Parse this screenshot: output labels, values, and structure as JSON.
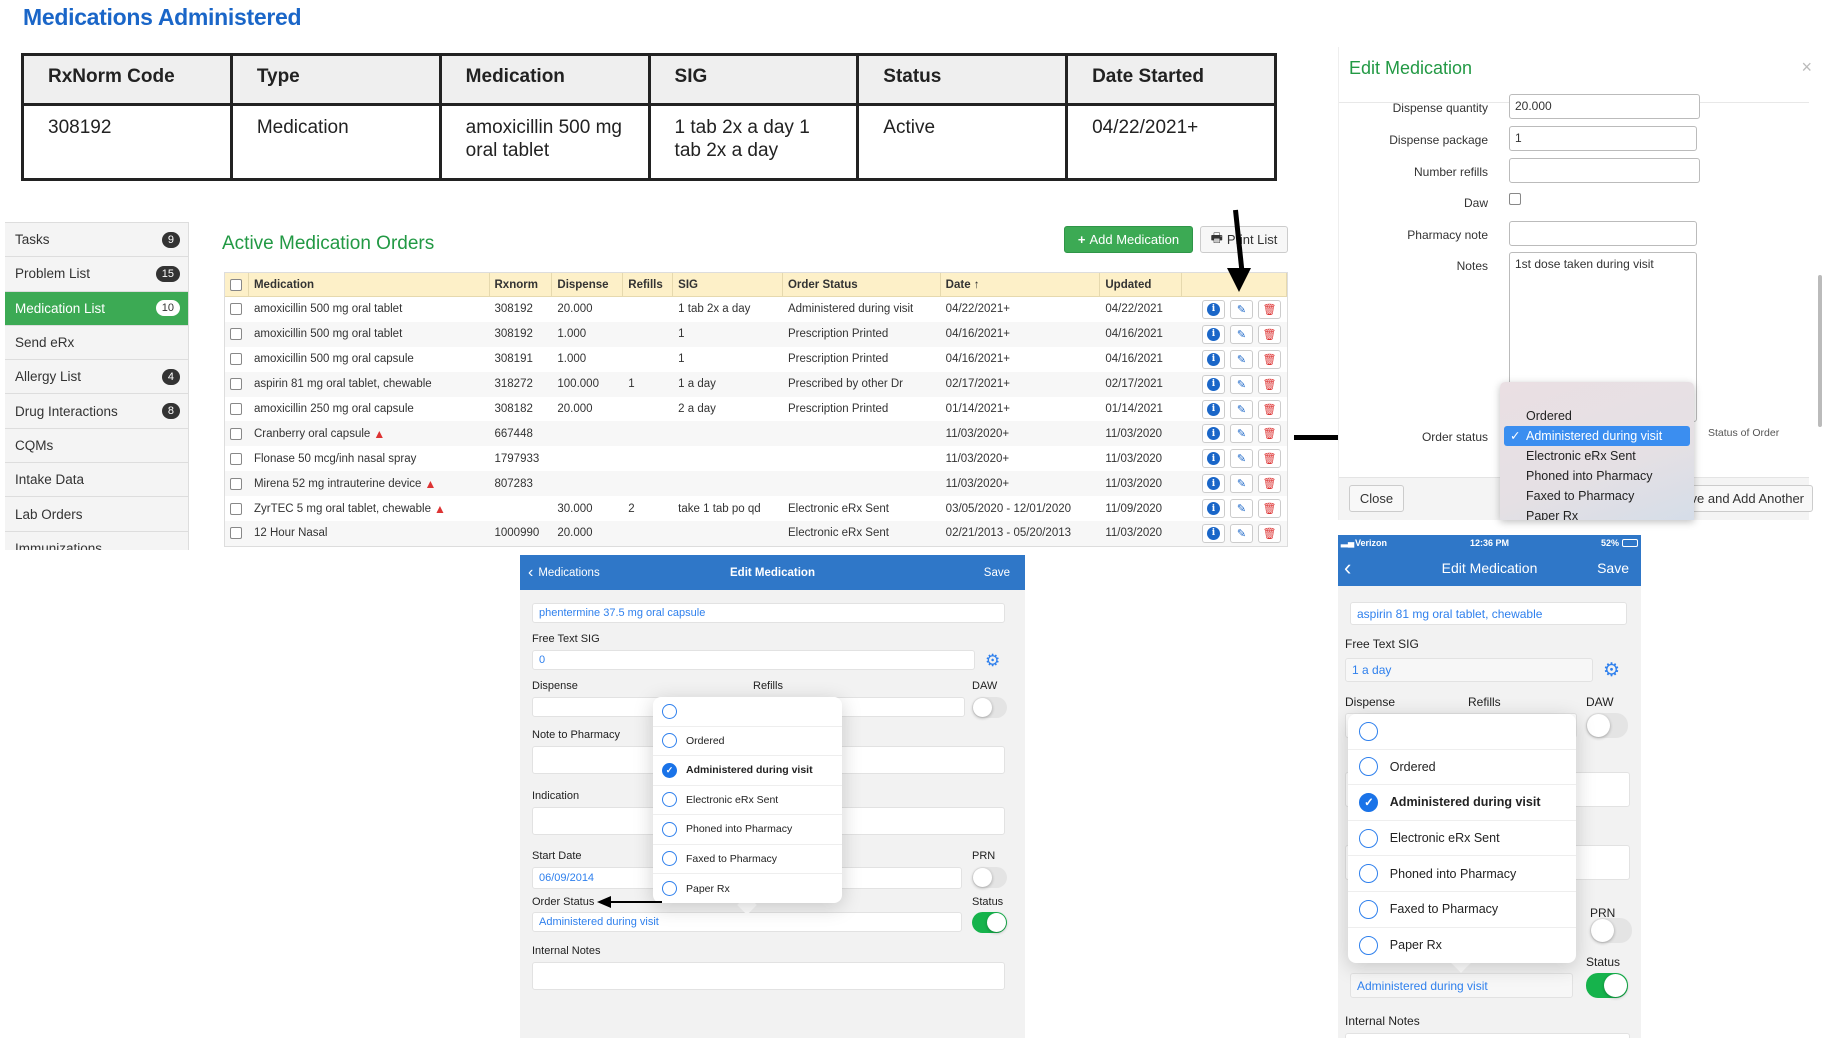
{
  "page_title": "Medications Administered",
  "administered_table": {
    "headers": [
      "RxNorm Code",
      "Type",
      "Medication",
      "SIG",
      "Status",
      "Date Started"
    ],
    "rows": [
      [
        "308192",
        "Medication",
        "amoxicillin 500 mg oral tablet",
        "1 tab 2x a day 1 tab 2x a day",
        "Active",
        "04/22/2021+"
      ]
    ]
  },
  "sidebar": {
    "items": [
      {
        "label": "Tasks",
        "badge": "9"
      },
      {
        "label": "Problem List",
        "badge": "15"
      },
      {
        "label": "Medication List",
        "badge": "10",
        "active": true
      },
      {
        "label": "Send eRx",
        "badge": ""
      },
      {
        "label": "Allergy List",
        "badge": "4"
      },
      {
        "label": "Drug Interactions",
        "badge": "8"
      },
      {
        "label": "CQMs",
        "badge": ""
      },
      {
        "label": "Intake Data",
        "badge": ""
      },
      {
        "label": "Lab Orders",
        "badge": ""
      },
      {
        "label": "Immunizations",
        "badge": ""
      }
    ]
  },
  "orders": {
    "title": "Active Medication Orders",
    "add_button": "Add Medication",
    "print_button": "Print List",
    "columns": [
      "Medication",
      "Rxnorm",
      "Dispense",
      "Refills",
      "SIG",
      "Order Status",
      "Date ↑",
      "Updated"
    ],
    "rows": [
      {
        "medication": "amoxicillin 500 mg oral tablet",
        "rxnorm": "308192",
        "dispense": "20.000",
        "refills": "",
        "sig": "1 tab 2x a day",
        "order_status": "Administered during visit",
        "date": "04/22/2021+",
        "updated": "04/22/2021",
        "warning": false
      },
      {
        "medication": "amoxicillin 500 mg oral tablet",
        "rxnorm": "308192",
        "dispense": "1.000",
        "refills": "",
        "sig": "1",
        "order_status": "Prescription Printed",
        "date": "04/16/2021+",
        "updated": "04/16/2021",
        "warning": false
      },
      {
        "medication": "amoxicillin 500 mg oral capsule",
        "rxnorm": "308191",
        "dispense": "1.000",
        "refills": "",
        "sig": "1",
        "order_status": "Prescription Printed",
        "date": "04/16/2021+",
        "updated": "04/16/2021",
        "warning": false
      },
      {
        "medication": "aspirin 81 mg oral tablet, chewable",
        "rxnorm": "318272",
        "dispense": "100.000",
        "refills": "1",
        "sig": "1 a day",
        "order_status": "Prescribed by other Dr",
        "date": "02/17/2021+",
        "updated": "02/17/2021",
        "warning": false
      },
      {
        "medication": "amoxicillin 250 mg oral capsule",
        "rxnorm": "308182",
        "dispense": "20.000",
        "refills": "",
        "sig": "2 a day",
        "order_status": "Prescription Printed",
        "date": "01/14/2021+",
        "updated": "01/14/2021",
        "warning": false
      },
      {
        "medication": "Cranberry oral capsule",
        "rxnorm": "667448",
        "dispense": "",
        "refills": "",
        "sig": "",
        "order_status": "",
        "date": "11/03/2020+",
        "updated": "11/03/2020",
        "warning": true
      },
      {
        "medication": "Flonase 50 mcg/inh nasal spray",
        "rxnorm": "1797933",
        "dispense": "",
        "refills": "",
        "sig": "",
        "order_status": "",
        "date": "11/03/2020+",
        "updated": "11/03/2020",
        "warning": false
      },
      {
        "medication": "Mirena 52 mg intrauterine device",
        "rxnorm": "807283",
        "dispense": "",
        "refills": "",
        "sig": "",
        "order_status": "",
        "date": "11/03/2020+",
        "updated": "11/03/2020",
        "warning": true
      },
      {
        "medication": "ZyrTEC 5 mg oral tablet, chewable",
        "rxnorm": "",
        "dispense": "30.000",
        "refills": "2",
        "sig": "take 1 tab po qd",
        "order_status": "Electronic eRx Sent",
        "date": "03/05/2020 - 12/01/2020",
        "updated": "11/09/2020",
        "warning": true
      },
      {
        "medication": "12 Hour Nasal",
        "rxnorm": "1000990",
        "dispense": "20.000",
        "refills": "",
        "sig": "",
        "order_status": "Electronic eRx Sent",
        "date": "02/21/2013 - 05/20/2013",
        "updated": "11/03/2020",
        "warning": false
      }
    ]
  },
  "edit_modal": {
    "title": "Edit Medication",
    "close_x": "×",
    "fields": {
      "dispense_quantity": {
        "label": "Dispense quantity",
        "value": "20.000"
      },
      "dispense_package": {
        "label": "Dispense package",
        "value": "1"
      },
      "number_refills": {
        "label": "Number refills",
        "value": ""
      },
      "daw": {
        "label": "Daw",
        "checked": false
      },
      "pharmacy_note": {
        "label": "Pharmacy note",
        "value": ""
      },
      "notes": {
        "label": "Notes",
        "value": "1st dose taken during visit"
      },
      "order_status": {
        "label": "Order status",
        "help": "Status of Order"
      }
    },
    "dropdown_options": [
      "Ordered",
      "Administered during visit",
      "Electronic eRx Sent",
      "Phoned into Pharmacy",
      "Faxed to Pharmacy",
      "Paper Rx"
    ],
    "selected_option": "Administered during visit",
    "close_button": "Close",
    "save_add_button": "ve and Add Another"
  },
  "ipad": {
    "back_label": "Medications",
    "title": "Edit Medication",
    "save": "Save",
    "medication": "phentermine 37.5 mg oral capsule",
    "labels": {
      "sig": "Free Text SIG",
      "dispense": "Dispense",
      "refills": "Refills",
      "daw": "DAW",
      "note": "Note to Pharmacy",
      "indication": "Indication",
      "start_date": "Start Date",
      "prn": "PRN",
      "order_status": "Order Status",
      "status": "Status",
      "internal_notes": "Internal Notes"
    },
    "sig": "0",
    "start_date": "06/09/2014",
    "order_status": "Administered during visit",
    "daw_on": false,
    "prn_on": false,
    "status_on": true,
    "options": [
      "",
      "Ordered",
      "Administered during visit",
      "Electronic eRx Sent",
      "Phoned into Pharmacy",
      "Faxed to Pharmacy",
      "Paper Rx"
    ],
    "selected_index": 2
  },
  "iphone": {
    "status_bar": {
      "carrier": "Verizon",
      "time": "12:36 PM",
      "battery": "52%"
    },
    "title": "Edit Medication",
    "save": "Save",
    "medication": "aspirin 81 mg oral tablet, chewable",
    "labels": {
      "sig": "Free Text SIG",
      "dispense": "Dispense",
      "refills": "Refills",
      "daw": "DAW",
      "prn": "PRN",
      "status": "Status",
      "internal_notes": "Internal Notes"
    },
    "sig": "1 a day",
    "order_status": "Administered during visit",
    "daw_on": false,
    "prn_on": false,
    "status_on": true,
    "options": [
      "",
      "Ordered",
      "Administered during visit",
      "Electronic eRx Sent",
      "Phoned into Pharmacy",
      "Faxed to Pharmacy",
      "Paper Rx"
    ],
    "selected_index": 2
  },
  "colors": {
    "title_blue": "#1a66c8",
    "green": "#3caa54",
    "ios_blue": "#2f77c8",
    "header_yellow": "#fdf0c8"
  }
}
